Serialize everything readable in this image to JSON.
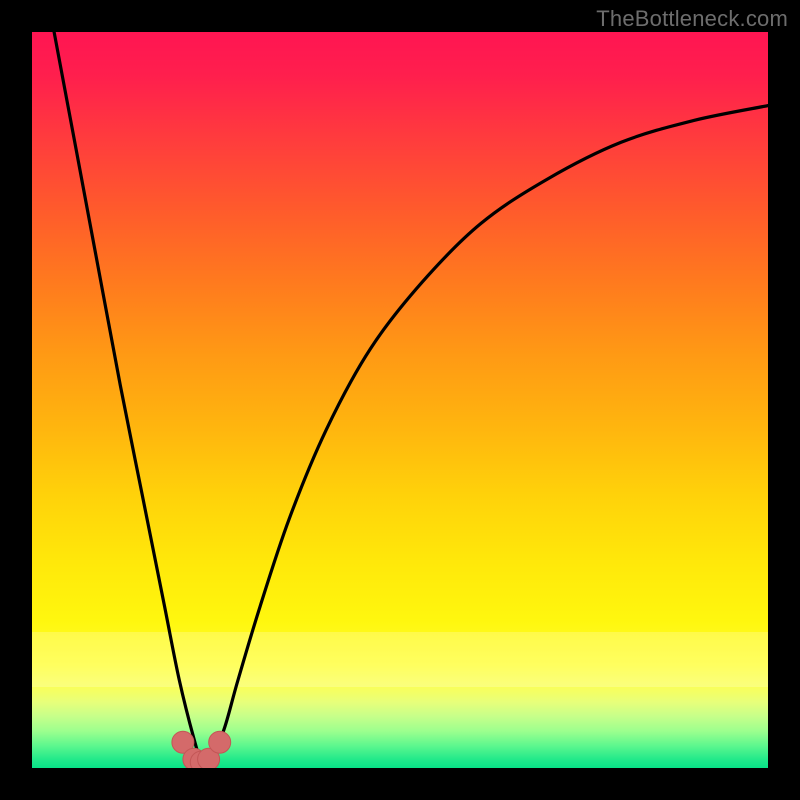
{
  "attribution": {
    "text": "TheBottleneck.com"
  },
  "colors": {
    "frame": "#000000",
    "curve_stroke": "#000000",
    "marker_fill": "#d46a6a",
    "marker_stroke": "#c35656",
    "text": "#6d6d6d"
  },
  "chart_data": {
    "type": "line",
    "title": "",
    "xlabel": "",
    "ylabel": "",
    "xlim": [
      0,
      100
    ],
    "ylim": [
      0,
      100
    ],
    "grid": false,
    "legend": false,
    "notes": "Bottleneck-style V-curve. y≈100 means near top of plot (high bottleneck), y≈0 is bottom (optimal). Minimum around x≈22–24.",
    "series": [
      {
        "name": "bottleneck-curve",
        "x": [
          3,
          6,
          9,
          12,
          15,
          18,
          20,
          22,
          23,
          24,
          26,
          28,
          31,
          35,
          40,
          46,
          53,
          61,
          70,
          80,
          90,
          100
        ],
        "y": [
          100,
          84,
          68,
          52,
          37,
          22,
          12,
          4,
          1,
          1,
          5,
          12,
          22,
          34,
          46,
          57,
          66,
          74,
          80,
          85,
          88,
          90
        ]
      }
    ],
    "markers": {
      "name": "optimal-region",
      "x": [
        20.5,
        22,
        23,
        24,
        25.5
      ],
      "y": [
        3.5,
        1.2,
        0.8,
        1.2,
        3.5
      ]
    }
  }
}
